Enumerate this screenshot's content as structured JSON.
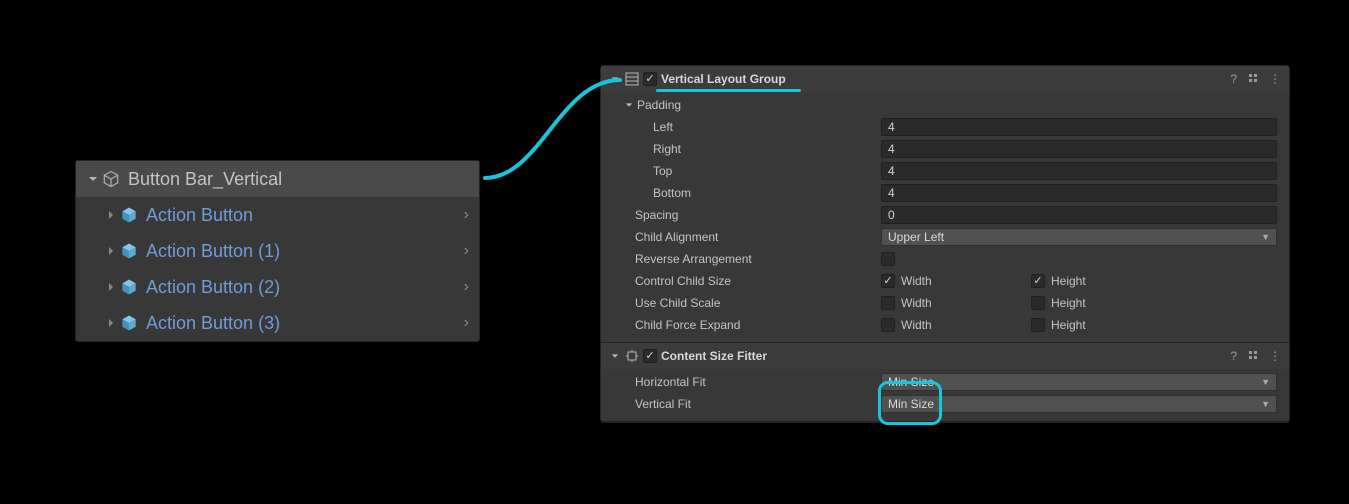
{
  "hierarchy": {
    "root": "Button Bar_Vertical",
    "children": [
      "Action Button",
      "Action Button (1)",
      "Action Button (2)",
      "Action Button (3)"
    ]
  },
  "vlg": {
    "title": "Vertical Layout Group",
    "padding_label": "Padding",
    "left_label": "Left",
    "left_value": "4",
    "right_label": "Right",
    "right_value": "4",
    "top_label": "Top",
    "top_value": "4",
    "bottom_label": "Bottom",
    "bottom_value": "4",
    "spacing_label": "Spacing",
    "spacing_value": "0",
    "child_alignment_label": "Child Alignment",
    "child_alignment_value": "Upper Left",
    "reverse_label": "Reverse Arrangement",
    "control_child_size_label": "Control Child Size",
    "use_child_scale_label": "Use Child Scale",
    "child_force_expand_label": "Child Force Expand",
    "width_label": "Width",
    "height_label": "Height"
  },
  "csf": {
    "title": "Content Size Fitter",
    "horizontal_fit_label": "Horizontal Fit",
    "horizontal_fit_value": "Min Size",
    "vertical_fit_label": "Vertical Fit",
    "vertical_fit_value": "Min Size"
  }
}
